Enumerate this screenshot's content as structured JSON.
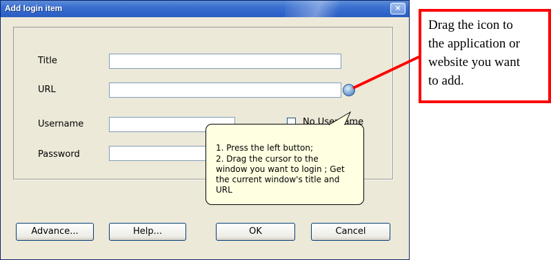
{
  "dialog": {
    "title": "Add login item",
    "close_glyph": "×"
  },
  "form": {
    "title_label": "Title",
    "title_value": "",
    "url_label": "URL",
    "url_value": "",
    "username_label": "Username",
    "username_value": "",
    "no_username_label": "No Username",
    "password_label": "Password",
    "password_value": "",
    "drag_icon": "globe-icon"
  },
  "tooltip": {
    "lines": [
      "1. Press the left button;",
      "2. Drag the cursor to the",
      "window you want to login ; Get",
      "the current window's title and",
      "URL"
    ]
  },
  "buttons": {
    "advance": "Advance...",
    "help": "Help...",
    "ok": "OK",
    "cancel": "Cancel"
  },
  "callout": {
    "lines": [
      "Drag the icon to",
      "the application or",
      "website you want",
      "to add."
    ],
    "border_color": "#ff0000"
  }
}
